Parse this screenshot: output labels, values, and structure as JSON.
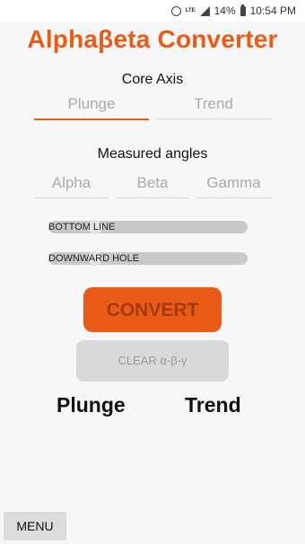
{
  "status_bar": {
    "network": "LTE",
    "battery": "14%",
    "time": "10:54 PM",
    "icons": [
      "alarm-icon",
      "lte-icon",
      "signal-icon",
      "battery-icon"
    ]
  },
  "app": {
    "title": "Alphaβeta Converter"
  },
  "core_axis": {
    "label": "Core Axis",
    "plunge_placeholder": "Plunge",
    "trend_placeholder": "Trend"
  },
  "measured_angles": {
    "label": "Measured angles",
    "alpha_placeholder": "Alpha",
    "beta_placeholder": "Beta",
    "gamma_placeholder": "Gamma"
  },
  "switches": {
    "bottom_line_label": "BOTTOM LINE",
    "downward_hole_label": "DOWNWARD HOLE"
  },
  "buttons": {
    "convert": "CONVERT",
    "clear": "CLEAR α-β-γ",
    "menu": "MENU"
  },
  "results": {
    "plunge_label": "Plunge",
    "trend_label": "Trend"
  },
  "colors": {
    "accent": "#ea5b17",
    "disabled_button": "#d9d9d9"
  }
}
